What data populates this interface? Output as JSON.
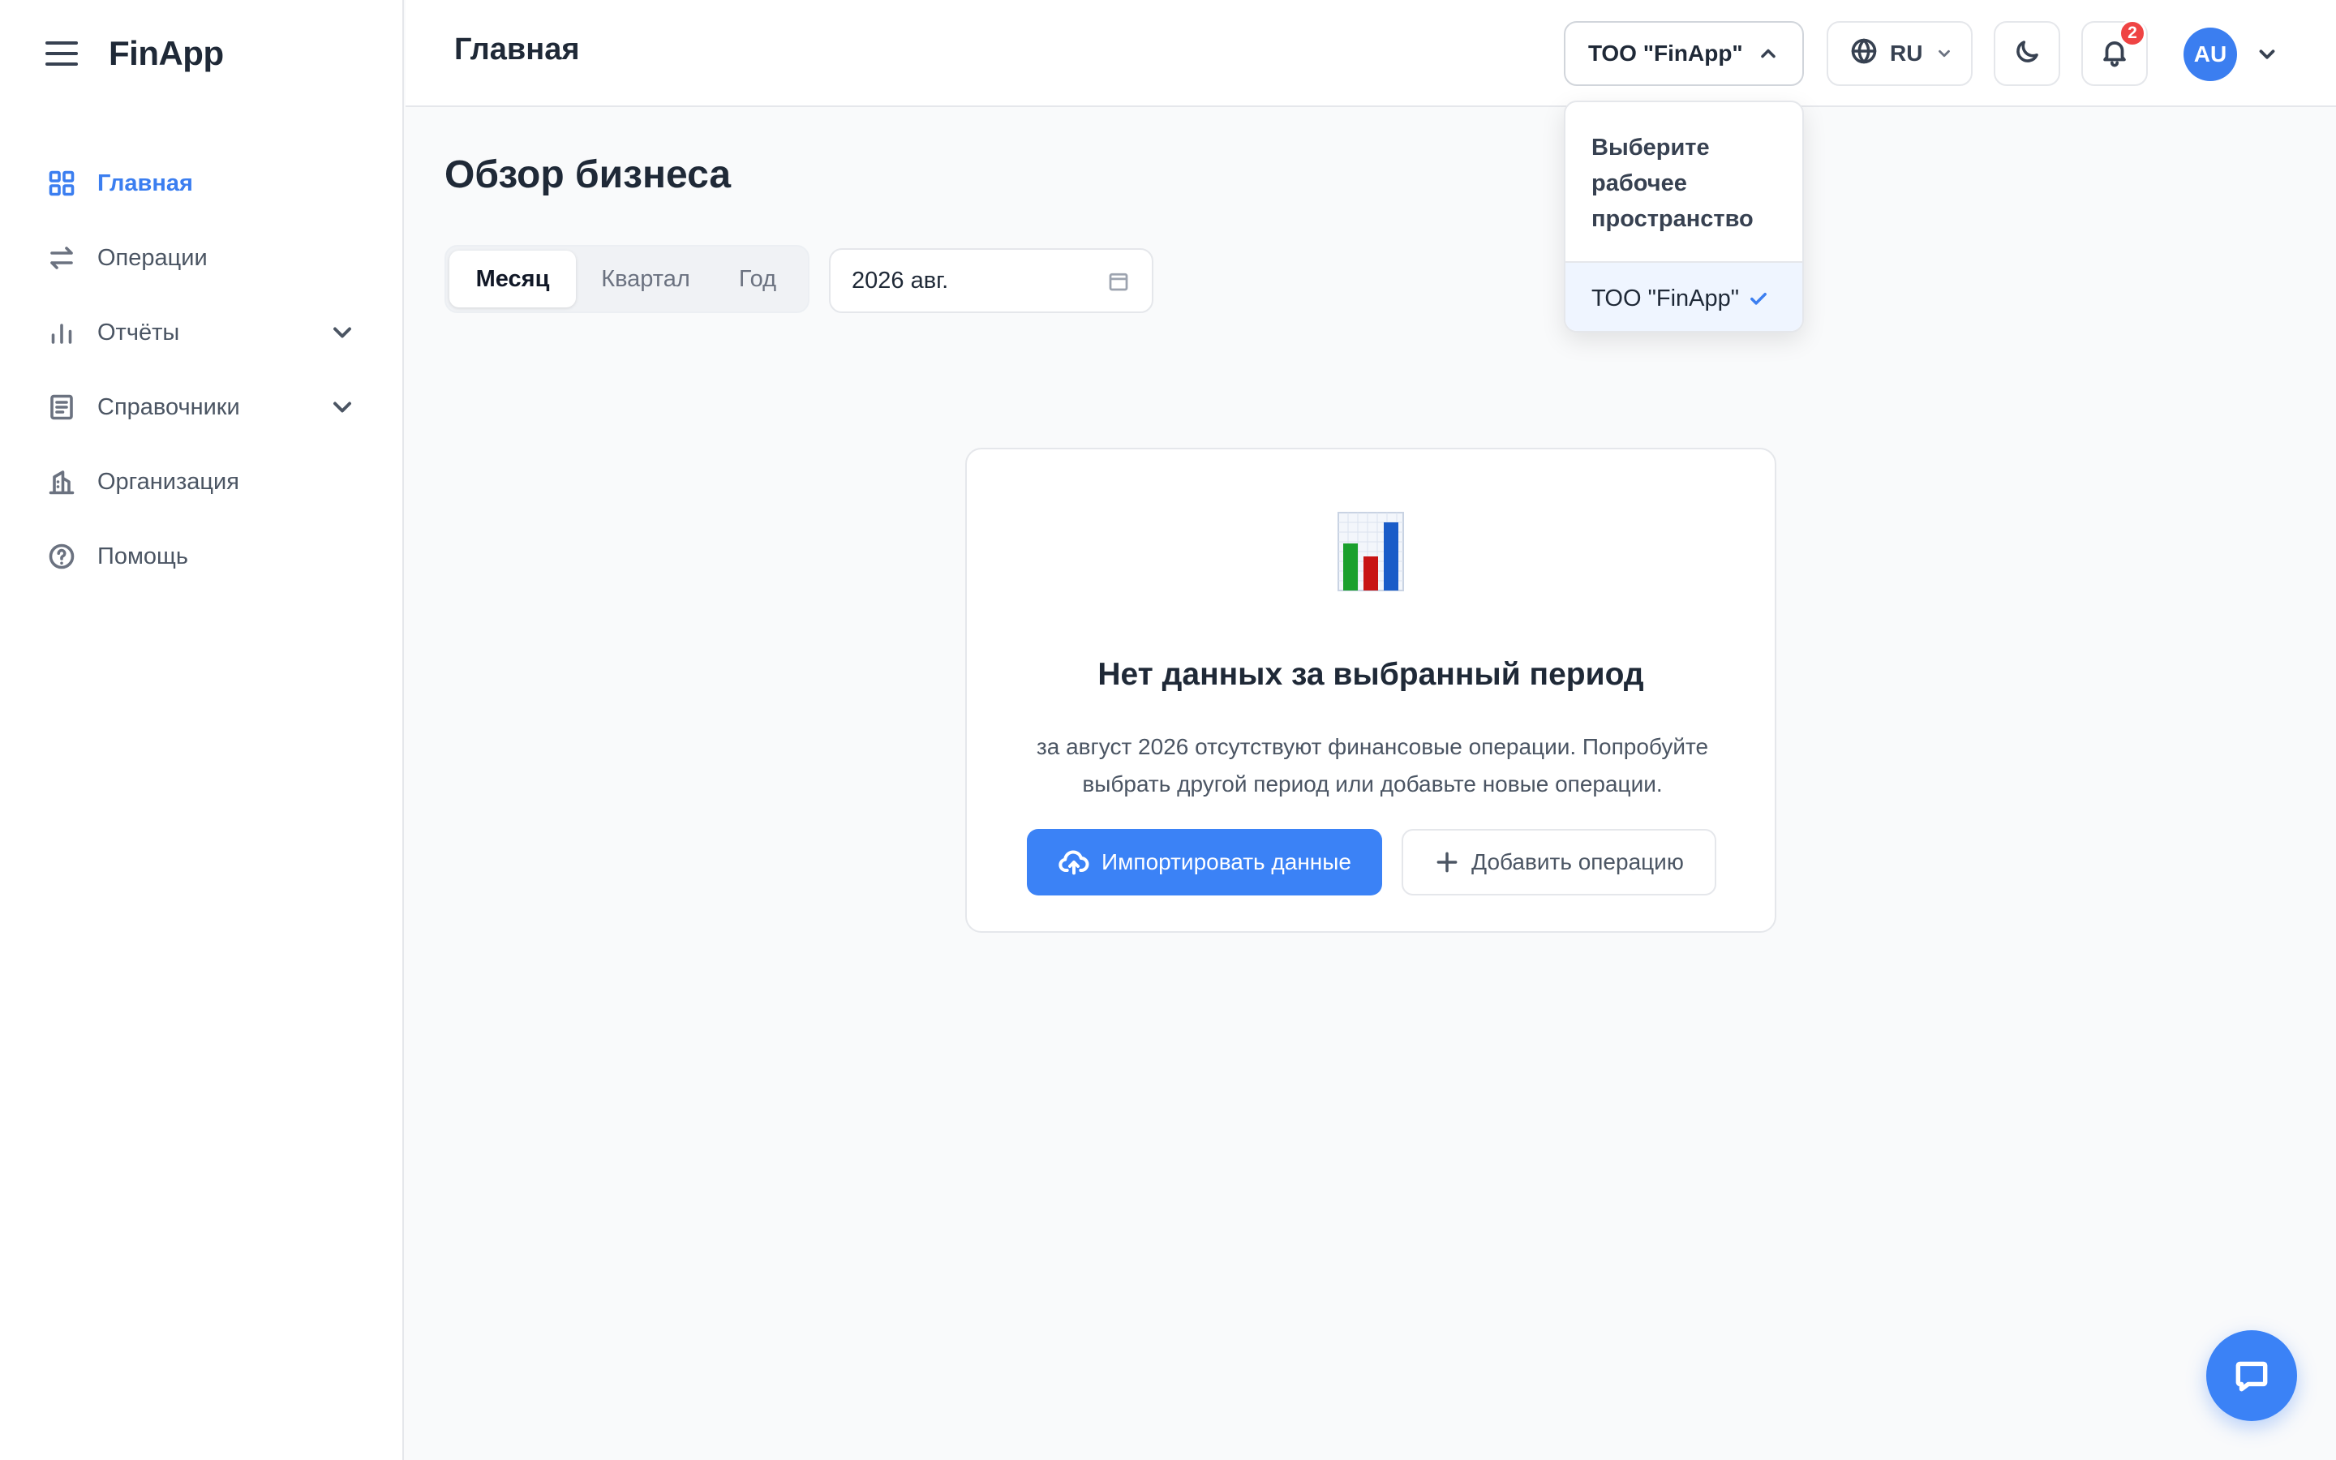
{
  "app": {
    "logo": "FinApp"
  },
  "sidebar": {
    "items": [
      {
        "label": "Главная",
        "icon": "grid-icon",
        "active": true
      },
      {
        "label": "Операции",
        "icon": "arrows-exchange-icon",
        "active": false
      },
      {
        "label": "Отчёты",
        "icon": "bar-chart-icon",
        "active": false,
        "expandable": true
      },
      {
        "label": "Справочники",
        "icon": "document-icon",
        "active": false,
        "expandable": true
      },
      {
        "label": "Организация",
        "icon": "building-icon",
        "active": false
      },
      {
        "label": "Помощь",
        "icon": "help-circle-icon",
        "active": false
      }
    ]
  },
  "header": {
    "title": "Главная",
    "workspace": "ТОО \"FinApp\"",
    "language": "RU",
    "notifications_count": "2",
    "avatar_initials": "AU"
  },
  "workspace_menu": {
    "title": "Выберите рабочее пространство",
    "options": [
      {
        "label": "ТОО \"FinApp\"",
        "selected": true
      }
    ]
  },
  "main": {
    "section_title": "Обзор бизнеса",
    "period_tabs": [
      "Месяц",
      "Квартал",
      "Год"
    ],
    "selected_period": "Месяц",
    "date_value": "2026 авг."
  },
  "empty_state": {
    "title": "Нет данных за выбранный период",
    "description": "за август 2026 отсутствуют финансовые операции. Попробуйте выбрать другой период или добавьте новые операции.",
    "import_button": "Импортировать данные",
    "add_button": "Добавить операцию"
  },
  "colors": {
    "accent": "#3b7ef0",
    "primary_button": "#3b82f6",
    "badge": "#ef4444",
    "selected_option_bg": "#eff5ff"
  }
}
